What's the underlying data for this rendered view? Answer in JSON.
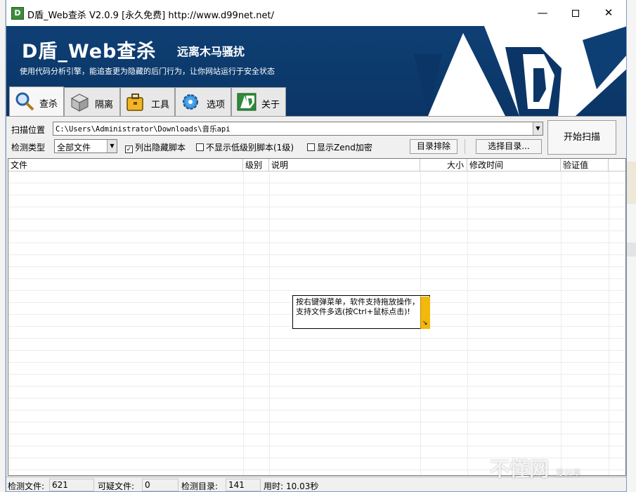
{
  "window": {
    "title": "D盾_Web查杀 V2.0.9 [永久免费] http://www.d99net.net/",
    "minimize": "—",
    "close": "✕"
  },
  "banner": {
    "title": "D盾_Web查杀",
    "subtitle": "远离木马骚扰",
    "description": "使用代码分析引擎，能追查更为隐藏的后门行为，让你网站运行于安全状态",
    "logo_text": "D"
  },
  "tabs": [
    {
      "label": "查杀",
      "icon": "magnifier-icon"
    },
    {
      "label": "隔离",
      "icon": "box-icon"
    },
    {
      "label": "工具",
      "icon": "briefcase-icon"
    },
    {
      "label": "选项",
      "icon": "gear-icon"
    },
    {
      "label": "关于",
      "icon": "d-logo-icon"
    }
  ],
  "scan": {
    "path_label": "扫描位置",
    "path_value": "C:\\Users\\Administrator\\Downloads\\音乐api",
    "type_label": "检测类型",
    "type_value": "全部文件",
    "chk_hidden": "列出隐藏脚本",
    "chk_hidden_checked": "✓",
    "chk_lowlevel": "不显示低级别脚本(1级)",
    "chk_zend": "显示Zend加密",
    "btn_exclude": "目录排除",
    "btn_choose": "选择目录...",
    "btn_start": "开始扫描"
  },
  "table": {
    "headers": [
      "文件",
      "级别",
      "说明",
      "大小",
      "修改时间",
      "验证值"
    ],
    "tooltip": "按右键弹菜单，软件支持拖放操作，支持文件多选(按Ctrl+鼠标点击)!"
  },
  "status": {
    "files_label": "检测文件:",
    "files_value": "621",
    "suspect_label": "可疑文件:",
    "suspect_value": "0",
    "dirs_label": "检测目录:",
    "dirs_value": "141",
    "time_label": "用时:",
    "time_value": "10.03秒"
  },
  "watermark": {
    "text": "不懂网",
    "sub": "爱分享"
  },
  "colors": {
    "banner_bg": "#0e3f74",
    "tooltip_corner": "#f2b80c"
  }
}
